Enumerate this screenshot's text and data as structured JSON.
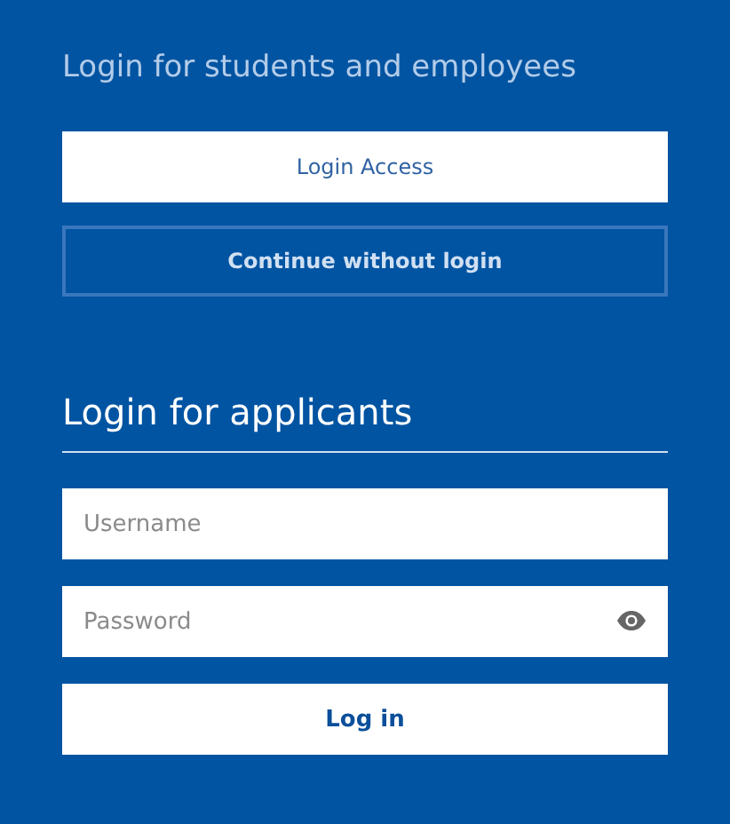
{
  "staff_login": {
    "title": "Login for students and employees",
    "buttons": [
      {
        "kind": "filled",
        "label": "Login Access"
      },
      {
        "kind": "outline",
        "label": "Continue without login"
      }
    ]
  },
  "applicant_login": {
    "title": "Login for applicants",
    "fields": [
      {
        "kind": "text",
        "placeholder": "Username"
      },
      {
        "kind": "password",
        "placeholder": "Password"
      }
    ],
    "submit": "Log in"
  }
}
